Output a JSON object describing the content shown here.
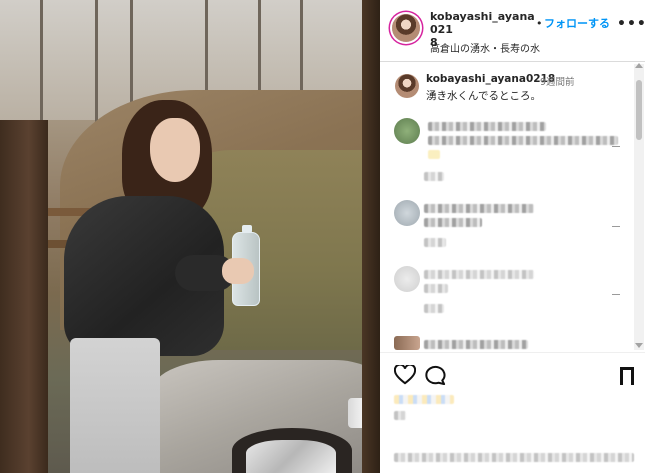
{
  "post": {
    "username": "kobayashi_ayana0218",
    "username_wrapped": "kobayashi_ayana021\n8",
    "separator": "•",
    "follow_label": "フォローする",
    "more_label": "•••",
    "location": "高倉山の湧水・長寿の水"
  },
  "caption": {
    "username": "kobayashi_ayana0218",
    "time": "9週間前",
    "text": "湧き水くんでるところ。"
  },
  "colors": {
    "follow": "#0095f6",
    "story_ring": "#d6249f",
    "text": "#262626",
    "muted": "#737373"
  },
  "icons": [
    "heart-icon",
    "comment-icon",
    "save-icon",
    "more-icon"
  ]
}
